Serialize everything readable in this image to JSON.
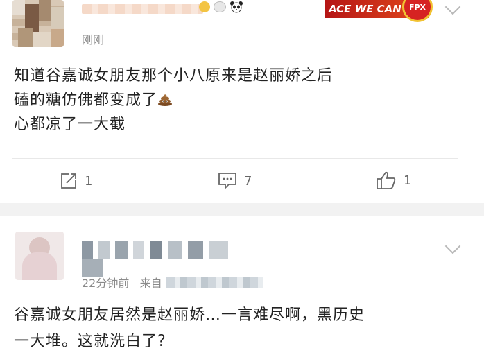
{
  "posts": [
    {
      "time": "刚刚",
      "badge_text": "ACE WE CAN",
      "badge_logo": "FPX",
      "content_lines": [
        "知道谷嘉诚女朋友那个小八原来是赵丽娇之后",
        "磕的糖仿佛都变成了",
        "心都凉了一大截"
      ],
      "emoji_icon": "poop-emoji-icon",
      "actions": {
        "repost_count": "1",
        "comment_count": "7",
        "like_count": "1"
      }
    },
    {
      "time": "22分钟前",
      "source_prefix": "来自",
      "content_lines": [
        "谷嘉诚女朋友居然是赵丽娇…一言难尽啊，黑历史",
        "一大堆。这就洗白了？"
      ]
    }
  ],
  "colors": {
    "text_primary": "#222222",
    "text_secondary": "#8a8a8a",
    "action_gray": "#666666",
    "separator": "#f2f2f2"
  }
}
